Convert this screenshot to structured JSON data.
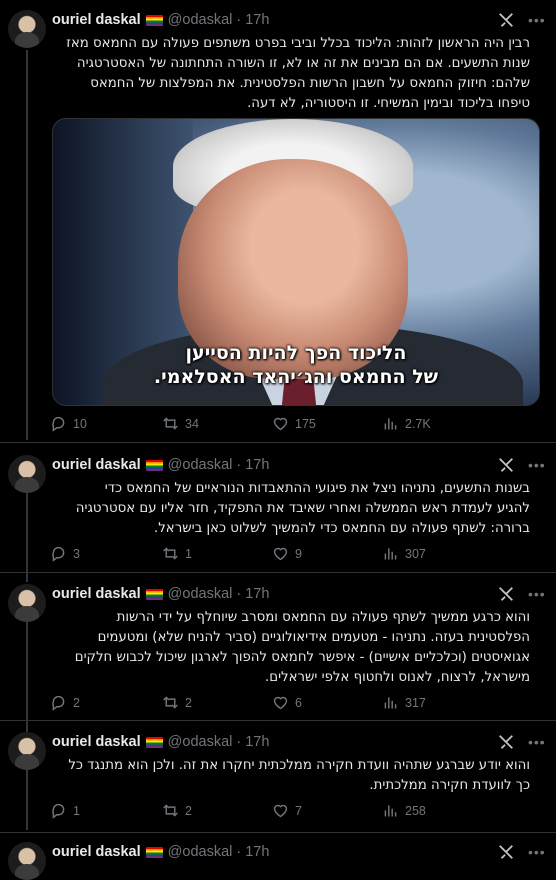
{
  "author": {
    "name": "ouriel daskal",
    "flag": "🏳️‍🌈",
    "handle": "@odaskal",
    "separator": "·"
  },
  "tweets": [
    {
      "time": "17h",
      "lines": [
        "רבין היה הראשון לזהות: הליכוד בכלל וביבי בפרט משתפים פעולה עם החמאס מאז",
        "שנות התשעים. אם הם מבינים את זה או לא, זו השורה התחתונה של האסטרטגיה",
        "שלהם: חיזוק החמאס על חשבון הרשות הפלסטינית. את המפלצות של החמאס",
        "טיפחו בליכוד ובימין המשיחי. זו היסטוריה, לא דעה."
      ],
      "media_caption": [
        "הליכוד הפך להיות הסייען",
        "של החמאס והג׳יהאד האסלאמי."
      ],
      "stats": {
        "replies": "10",
        "retweets": "34",
        "likes": "175",
        "views": "2.7K"
      }
    },
    {
      "time": "17h",
      "lines": [
        "בשנות התשעים, נתניהו ניצל את פיגועי ההתאבדות הנוראיים של החמאס כדי",
        "להגיע לעמדת ראש הממשלה ואחרי שאיבד את התפקיד, חזר אליו עם אסטרטגיה",
        "ברורה: לשתף פעולה עם החמאס כדי להמשיך לשלוט כאן בישראל."
      ],
      "stats": {
        "replies": "3",
        "retweets": "1",
        "likes": "9",
        "views": "307"
      }
    },
    {
      "time": "17h",
      "lines": [
        "והוא כרגע ממשיך לשתף פעולה עם החמאס ומסרב שיוחלף על ידי הרשות",
        "הפלסטינית בעזה. נתניהו - מטעמים אידיאולוגיים (סביר להניח שלא) ומטעמים",
        "אגואיסטים (וכלכליים אישיים) - איפשר לחמאס להפוך לארגון שיכול לכבוש חלקים",
        "מישראל, לרצוח, לאנוס ולחטוף אלפי ישראלים."
      ],
      "stats": {
        "replies": "2",
        "retweets": "2",
        "likes": "6",
        "views": "317"
      }
    },
    {
      "time": "17h",
      "lines": [
        "והוא יודע שברגע שתהיה וועדת חקירה ממלכתית יחקרו את זה. ולכן הוא מתנגד כל",
        "כך לוועדת חקירה ממלכתית."
      ],
      "stats": {
        "replies": "1",
        "retweets": "2",
        "likes": "7",
        "views": "258"
      }
    },
    {
      "time": "17h"
    }
  ],
  "icons": [
    "grok-icon",
    "more-icon",
    "reply-icon",
    "retweet-icon",
    "like-icon",
    "views-icon"
  ],
  "colors": {
    "background": "#000000",
    "muted": "#71767b",
    "text": "#e7e9ea",
    "divider": "#2f3336"
  }
}
